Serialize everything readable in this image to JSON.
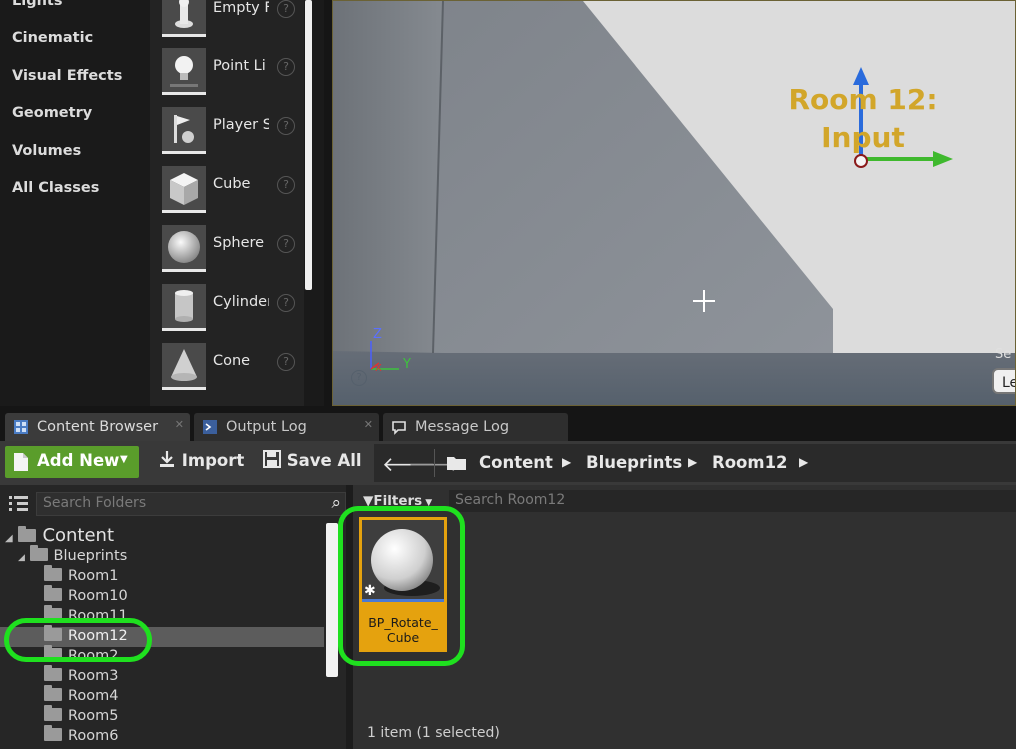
{
  "place_mode": {
    "categories": [
      "Lights",
      "Cinematic",
      "Visual Effects",
      "Geometry",
      "Volumes",
      "All Classes"
    ],
    "assets": [
      {
        "label": "Empty F",
        "icon": "empty-actor-icon"
      },
      {
        "label": "Point Li",
        "icon": "lightbulb-icon"
      },
      {
        "label": "Player S",
        "icon": "player-start-icon"
      },
      {
        "label": "Cube",
        "icon": "cube-icon"
      },
      {
        "label": "Sphere",
        "icon": "sphere-icon"
      },
      {
        "label": "Cylinder",
        "icon": "cylinder-icon"
      },
      {
        "label": "Cone",
        "icon": "cone-icon"
      }
    ],
    "help_glyph": "?"
  },
  "viewport": {
    "label_line1": "Room 12:",
    "label_line2": "Input",
    "axis_z": "Z",
    "axis_y": "Y",
    "axis_x": "X",
    "corner_text_1": "Se",
    "corner_button": "Le"
  },
  "tabs": [
    {
      "label": "Content Browser",
      "icon": "content-browser-icon",
      "active": true
    },
    {
      "label": "Output Log",
      "icon": "output-log-icon",
      "active": false
    },
    {
      "label": "Message Log",
      "icon": "message-log-icon",
      "active": false
    }
  ],
  "toolbar": {
    "add_new": "Add New",
    "import": "Import",
    "save_all": "Save All"
  },
  "breadcrumb": [
    "Content",
    "Blueprints",
    "Room12"
  ],
  "folders": {
    "search_placeholder": "Search Folders",
    "tree": [
      {
        "label": "Content",
        "level": 0
      },
      {
        "label": "Blueprints",
        "level": 1
      },
      {
        "label": "Room1",
        "level": 2
      },
      {
        "label": "Room10",
        "level": 2
      },
      {
        "label": "Room11",
        "level": 2
      },
      {
        "label": "Room12",
        "level": 2,
        "selected": true
      },
      {
        "label": "Room2",
        "level": 2
      },
      {
        "label": "Room3",
        "level": 2
      },
      {
        "label": "Room4",
        "level": 2
      },
      {
        "label": "Room5",
        "level": 2
      },
      {
        "label": "Room6",
        "level": 2
      }
    ]
  },
  "assets_view": {
    "filters_label": "Filters",
    "search_placeholder": "Search Room12",
    "asset_name_line1": "BP_Rotate_",
    "asset_name_line2": "Cube",
    "item_count": "1 item (1 selected)"
  },
  "colors": {
    "add_new_green": "#5a9d2b",
    "asset_tile_orange": "#e5a20e",
    "highlight_green": "#1fe01f",
    "viewport_label": "#d2a62a"
  }
}
